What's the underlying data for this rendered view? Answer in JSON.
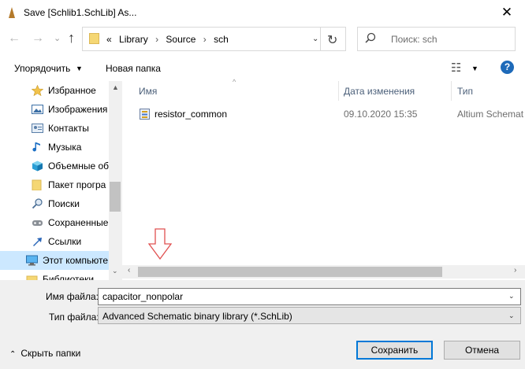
{
  "window": {
    "title": "Save [Schlib1.SchLib] As...",
    "close_glyph": "✕"
  },
  "nav": {
    "back_glyph": "←",
    "forward_glyph": "→",
    "up_glyph": "↑",
    "breadcrumb_overflow": "«",
    "breadcrumb": [
      "Library",
      "Source",
      "sch"
    ],
    "breadcrumb_sep": "›",
    "refresh_glyph": "↻",
    "search_placeholder": "Поиск: sch"
  },
  "toolbar": {
    "sort_label": "Упорядочить",
    "new_folder_label": "Новая папка",
    "help_glyph": "?"
  },
  "sidebar": {
    "items": [
      {
        "label": "Избранное",
        "icon": "star-icon"
      },
      {
        "label": "Изображения",
        "icon": "pictures-icon"
      },
      {
        "label": "Контакты",
        "icon": "contacts-icon"
      },
      {
        "label": "Музыка",
        "icon": "music-icon"
      },
      {
        "label": "Объемные об",
        "icon": "3d-objects-icon"
      },
      {
        "label": "Пакет програ",
        "icon": "folder-icon"
      },
      {
        "label": "Поиски",
        "icon": "search-icon"
      },
      {
        "label": "Сохраненные",
        "icon": "saved-games-icon"
      },
      {
        "label": "Ссылки",
        "icon": "links-icon"
      },
      {
        "label": "Этот компьюте",
        "icon": "computer-icon",
        "selected": true
      },
      {
        "label": "Библиотеки",
        "icon": "libraries-icon"
      }
    ]
  },
  "file_list": {
    "columns": [
      "Имя",
      "Дата изменения",
      "Тип"
    ],
    "rows": [
      {
        "name": "resistor_common",
        "date": "09.10.2020 15:35",
        "type": "Altium Schemat"
      }
    ]
  },
  "form": {
    "filename_label": "Имя файла:",
    "filename_value": "capacitor_nonpolar",
    "filetype_label": "Тип файла:",
    "filetype_value": "Advanced Schematic binary library (*.SchLib)",
    "hide_folders_label": "Скрыть папки",
    "save_label": "Сохранить",
    "cancel_label": "Отмена"
  },
  "colors": {
    "accent": "#0078d7",
    "selection": "#cce8ff",
    "help": "#1e6ab9",
    "annotation_arrow": "#e05050"
  }
}
